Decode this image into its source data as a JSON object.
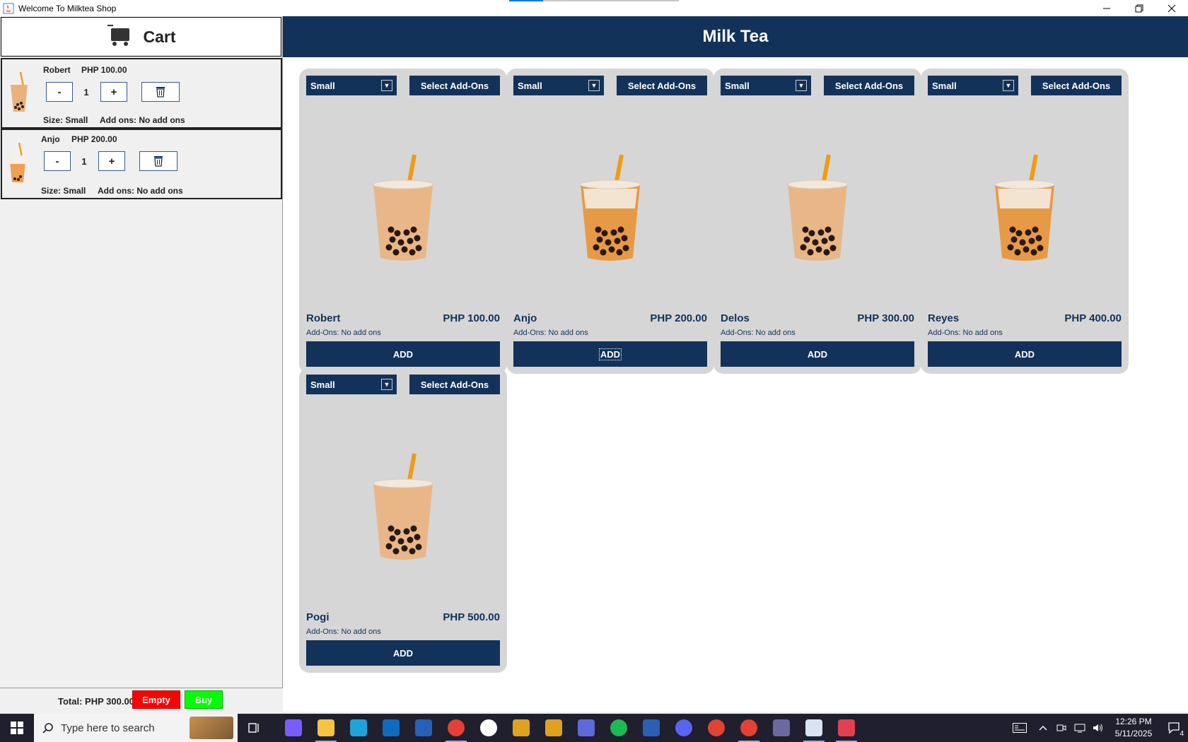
{
  "window": {
    "title": "Welcome To Milktea Shop",
    "progress": 0.2,
    "controls": [
      "minimize",
      "restore",
      "close"
    ]
  },
  "cart": {
    "title": "Cart",
    "items": [
      {
        "name": "Robert",
        "price": "PHP 100.00",
        "qty": "1",
        "minus": "-",
        "plus": "+",
        "size": "Size: Small",
        "addons": "Add ons: No add ons"
      },
      {
        "name": "Anjo",
        "price": "PHP 200.00",
        "qty": "1",
        "minus": "-",
        "plus": "+",
        "size": "Size: Small",
        "addons": "Add ons: No add ons"
      }
    ],
    "total": "Total: PHP 300.00",
    "empty_label": "Empty",
    "buy_label": "Buy",
    "colors": {
      "empty": "#ff0000",
      "buy": "#00ff00"
    }
  },
  "main": {
    "title": "Milk Tea",
    "accent": "#12325a",
    "products": [
      {
        "name": "Robert",
        "price": "PHP 100.00",
        "size": "Small",
        "addons_button": "Select Add-Ons",
        "addons": "Add-Ons: No add ons",
        "add_label": "ADD",
        "variant": "classic"
      },
      {
        "name": "Anjo",
        "price": "PHP 200.00",
        "size": "Small",
        "addons_button": "Select Add-Ons",
        "addons": "Add-Ons: No add ons",
        "add_label": "ADD",
        "variant": "caramel"
      },
      {
        "name": "Delos",
        "price": "PHP 300.00",
        "size": "Small",
        "addons_button": "Select Add-Ons",
        "addons": "Add-Ons: No add ons",
        "add_label": "ADD",
        "variant": "classic"
      },
      {
        "name": "Reyes",
        "price": "PHP 400.00",
        "size": "Small",
        "addons_button": "Select Add-Ons",
        "addons": "Add-Ons: No add ons",
        "add_label": "ADD",
        "variant": "caramel"
      },
      {
        "name": "Pogi",
        "price": "PHP 500.00",
        "size": "Small",
        "addons_button": "Select Add-Ons",
        "addons": "Add-Ons: No add ons",
        "add_label": "ADD",
        "variant": "classic"
      }
    ]
  },
  "taskbar": {
    "search_placeholder": "Type here to search",
    "apps": [
      "copilot-icon",
      "file-explorer-icon",
      "edge-icon",
      "outlook-icon",
      "dev-home-icon",
      "chrome-icon",
      "github-icon",
      "badge-icon",
      "badge-icon",
      "m365-icon",
      "spotify-icon",
      "powershell-icon",
      "discord-icon",
      "chrome-icon",
      "chrome-icon",
      "stack-icon",
      "java-icon",
      "snipping-tool-icon"
    ],
    "time": "12:26 PM",
    "date": "5/11/2025",
    "notifications": "4"
  }
}
